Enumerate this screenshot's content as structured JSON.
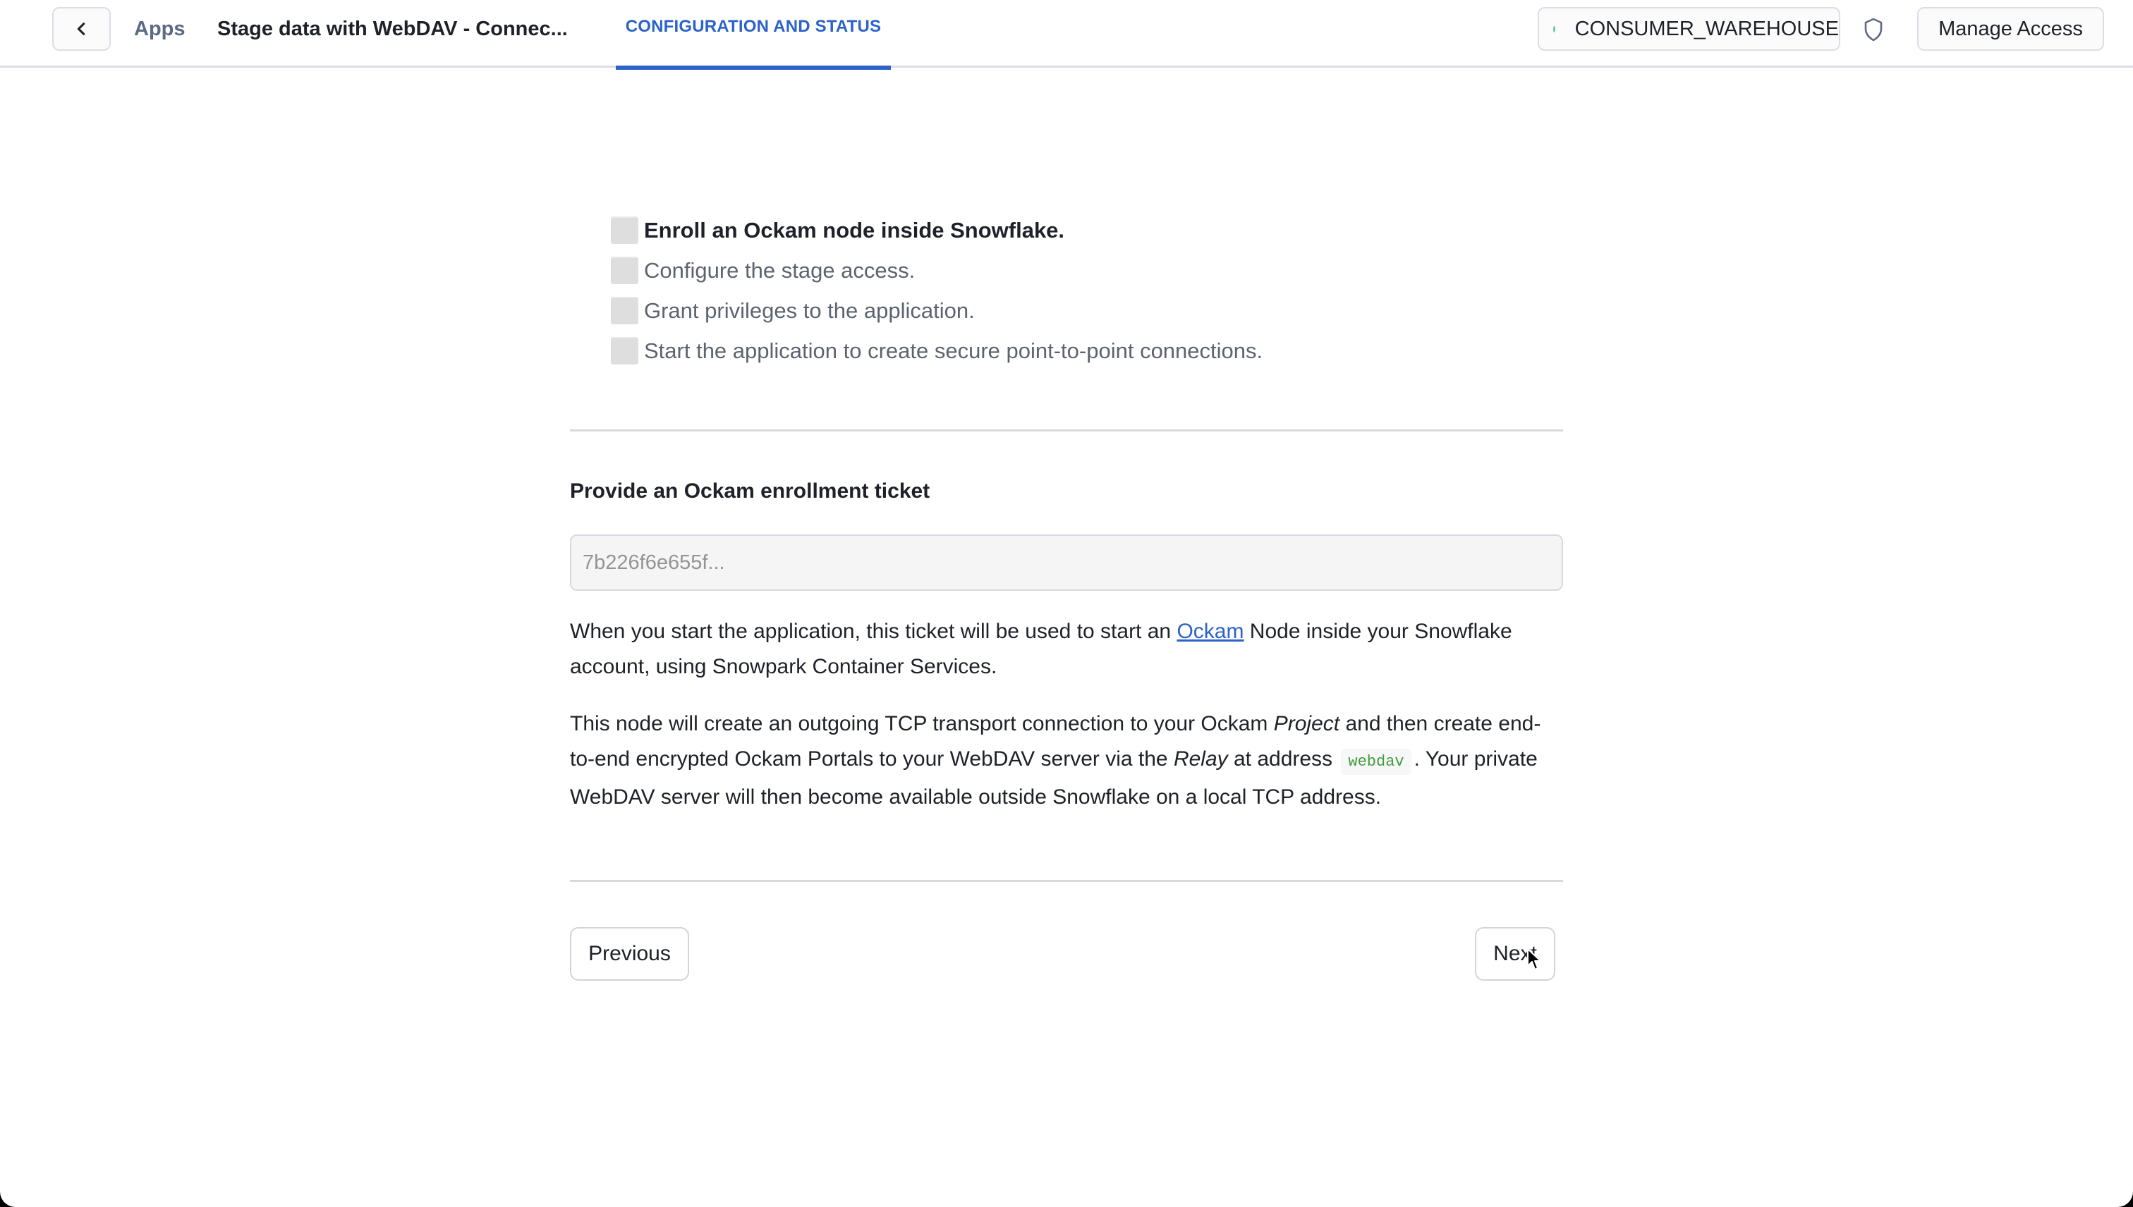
{
  "header": {
    "back_icon": "chevron-left-icon",
    "breadcrumb_apps": "Apps",
    "app_title": "Stage data with WebDAV - Connec...",
    "tabs": [
      {
        "label": "CONFIGURATION AND STATUS",
        "active": true
      }
    ],
    "warehouse": {
      "name": "CONSUMER_WAREHOUSE",
      "status_color": "#6cc5a0"
    },
    "shield_icon": "shield-icon",
    "manage_access_label": "Manage Access"
  },
  "steps": [
    {
      "label": "Enroll an Ockam node inside Snowflake.",
      "active": true,
      "checked": false
    },
    {
      "label": "Configure the stage access.",
      "active": false,
      "checked": false
    },
    {
      "label": "Grant privileges to the application.",
      "active": false,
      "checked": false
    },
    {
      "label": "Start the application to create secure point-to-point connections.",
      "active": false,
      "checked": false
    }
  ],
  "form": {
    "heading": "Provide an Ockam enrollment ticket",
    "ticket_placeholder": "7b226f6e655f...",
    "ticket_value": ""
  },
  "description": {
    "p1_before_link": "When you start the application, this ticket will be used to start an ",
    "p1_link": "Ockam",
    "p1_after_link": " Node inside your Snowflake account, using Snowpark Container Services.",
    "p2_part1": "This node will create an outgoing TCP transport connection to your Ockam ",
    "p2_em1": "Project",
    "p2_part2": " and then create end-to-end encrypted Ockam Portals to your WebDAV server via the ",
    "p2_em2": "Relay",
    "p2_part3": " at address ",
    "p2_code": "webdav",
    "p2_part4": ". Your private WebDAV server will then become available outside Snowflake on a local TCP address."
  },
  "navigation": {
    "previous_label": "Previous",
    "next_label": "Next"
  },
  "colors": {
    "accent": "#2c62c9",
    "code_text": "#3f9c3f",
    "warehouse_status": "#6cc5a0"
  }
}
